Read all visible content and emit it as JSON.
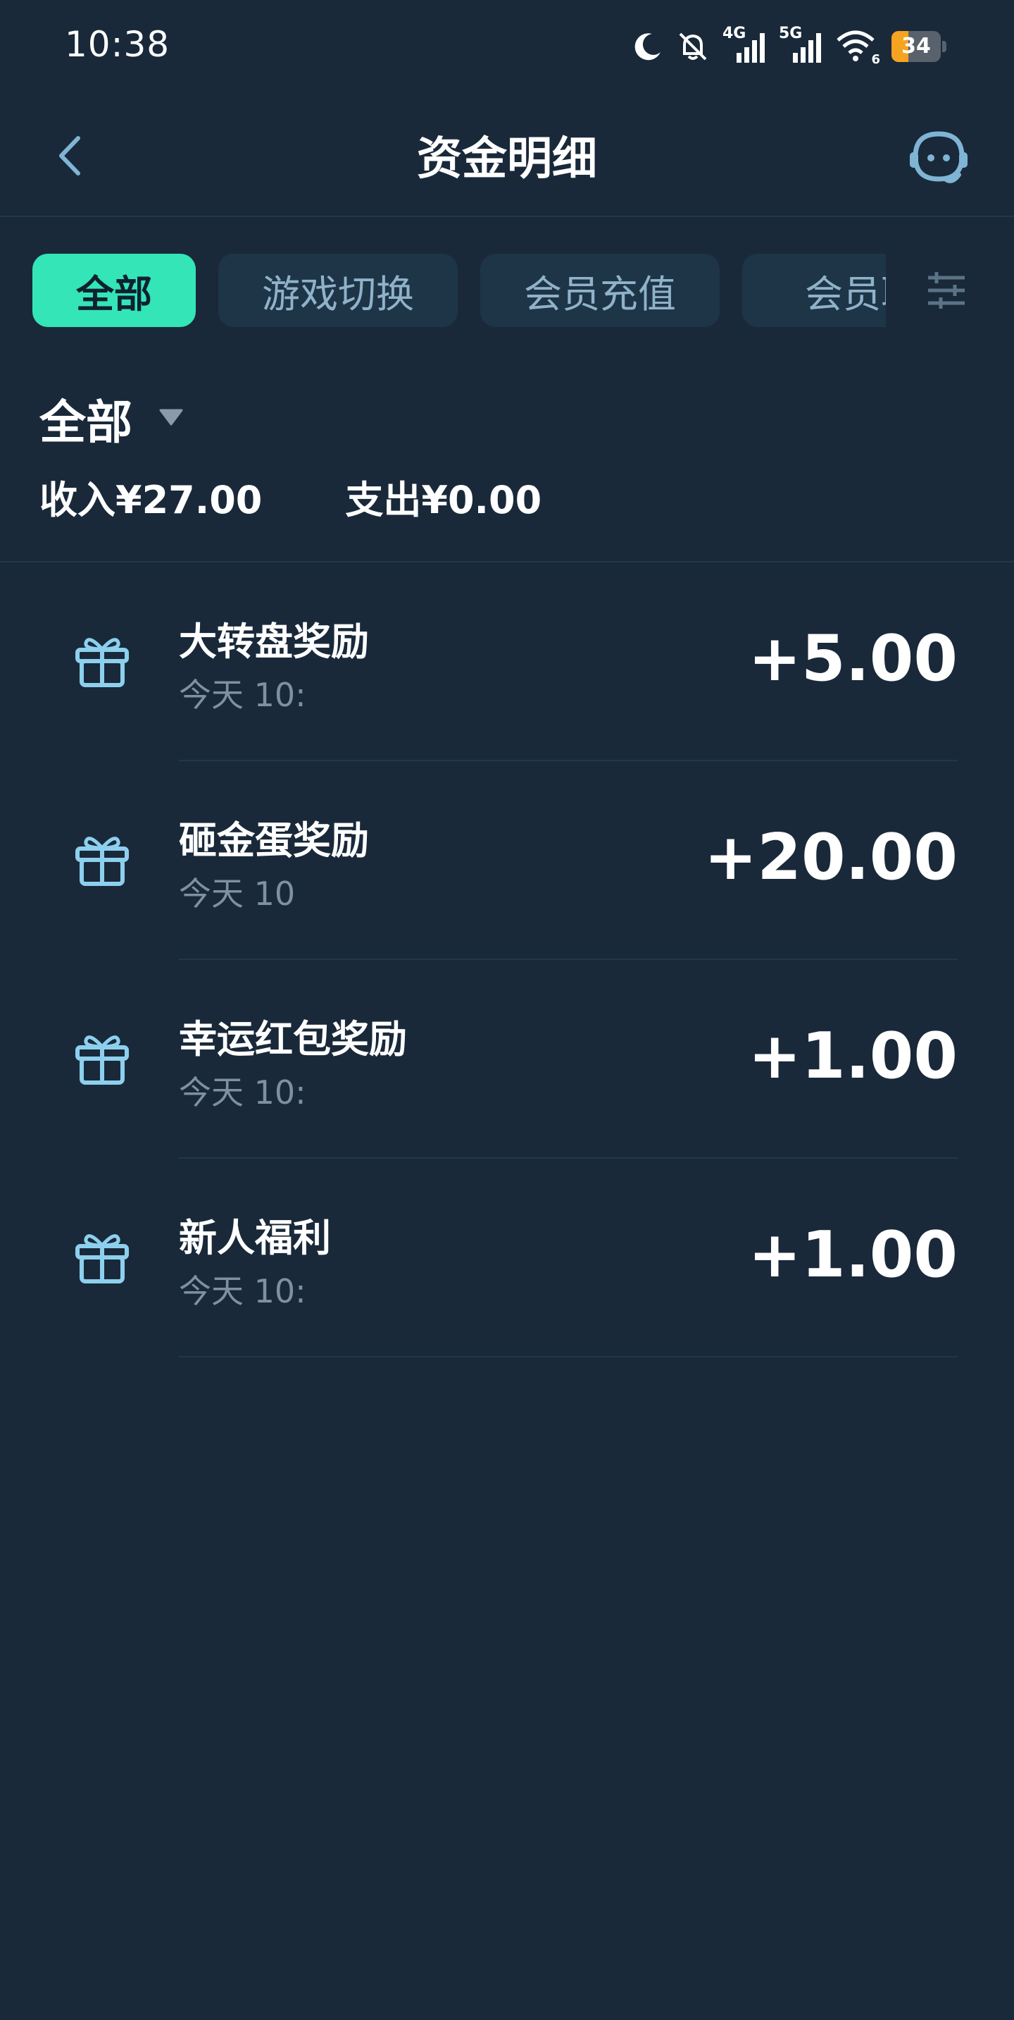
{
  "status_bar": {
    "time": "10:38",
    "network_1": "4G",
    "network_2": "5G",
    "wifi_level": "6",
    "battery": "34",
    "icons": [
      "moon-icon",
      "bell-off-icon",
      "signal-icon",
      "signal-icon",
      "wifi-icon",
      "battery-icon"
    ],
    "battery_color": "#f5a321"
  },
  "nav": {
    "title": "资金明细",
    "back_icon": "chevron-left-icon",
    "support_icon": "customer-service-icon"
  },
  "tabs": {
    "items": [
      {
        "label": "全部",
        "active": true
      },
      {
        "label": "游戏切换",
        "active": false
      },
      {
        "label": "会员充值",
        "active": false
      },
      {
        "label": "会员取",
        "active": false
      }
    ],
    "filter_icon": "sliders-icon",
    "accent_color": "#33e5b7"
  },
  "summary": {
    "filter_label": "全部",
    "income": "收入¥27.00",
    "expense": "支出¥0.00"
  },
  "records": [
    {
      "title": "大转盘奖励",
      "time": "今天 10:",
      "amount": "+5.00",
      "icon": "gift-icon"
    },
    {
      "title": "砸金蛋奖励",
      "time": "今天 10",
      "amount": "+20.00",
      "icon": "gift-icon"
    },
    {
      "title": "幸运红包奖励",
      "time": "今天 10:",
      "amount": "+1.00",
      "icon": "gift-icon"
    },
    {
      "title": "新人福利",
      "time": "今天 10:",
      "amount": "+1.00",
      "icon": "gift-icon"
    }
  ]
}
